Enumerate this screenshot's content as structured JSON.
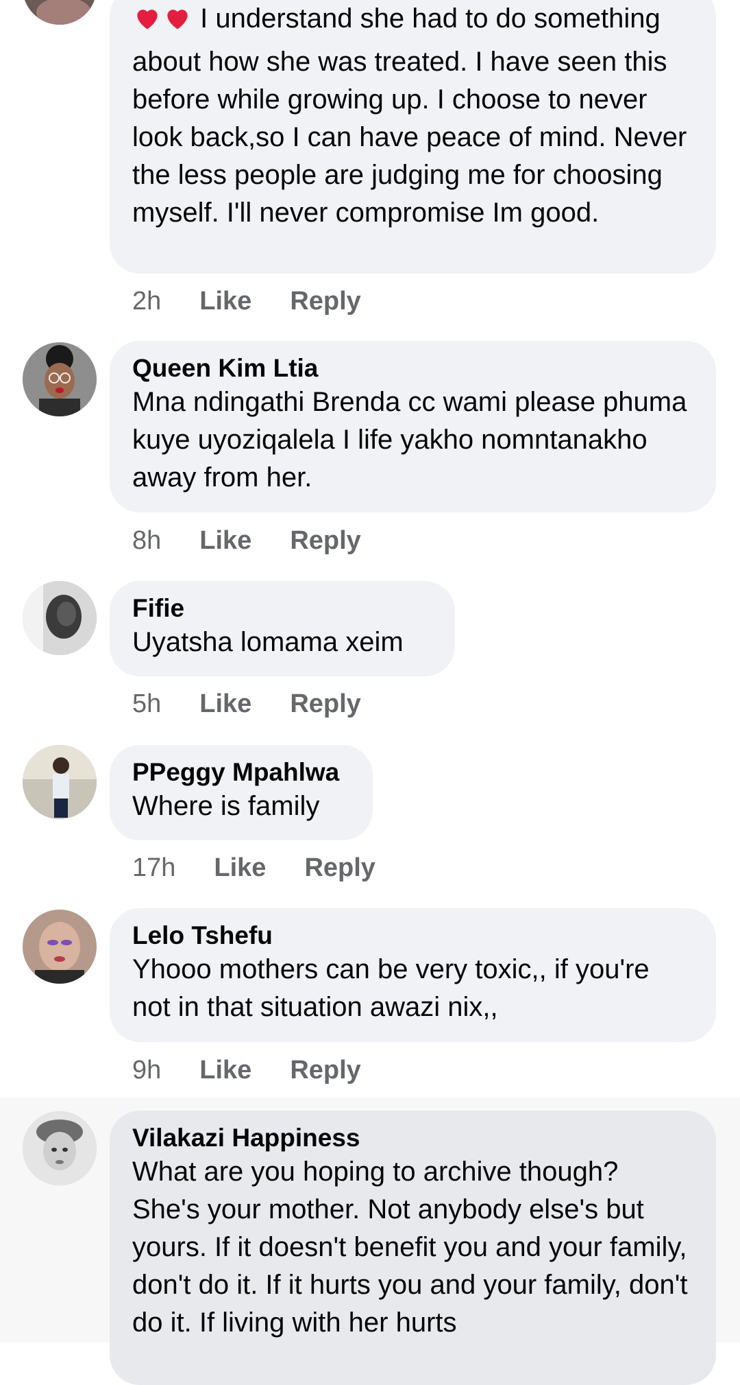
{
  "comments": [
    {
      "text_prefix_emoji": "❤️❤️",
      "text": "I understand she had to do something about how she was treated. I have seen this before while growing up. I choose to never look back,so I can have peace of mind. Never the less people are judging me for choosing myself. I'll never compromise Im good.",
      "time": "2h",
      "like": "Like",
      "reply": "Reply"
    },
    {
      "name": "Queen Kim Ltia",
      "text": "Mna ndingathi Brenda cc wami please phuma kuye uyoziqalela I life yakho nomntanakho away from her.",
      "time": "8h",
      "like": "Like",
      "reply": "Reply"
    },
    {
      "name": "Fifie",
      "text": "Uyatsha lomama xeim",
      "time": "5h",
      "like": "Like",
      "reply": "Reply"
    },
    {
      "name": "PPeggy Mpahlwa",
      "text": "Where is family",
      "time": "17h",
      "like": "Like",
      "reply": "Reply"
    },
    {
      "name": "Lelo Tshefu",
      "text": "Yhooo mothers can be very toxic,, if you're not in that situation awazi nix,,",
      "time": "9h",
      "like": "Like",
      "reply": "Reply"
    },
    {
      "name": "Vilakazi Happiness",
      "text": "What are you hoping to archive though? She's your mother. Not anybody else's but yours. If it doesn't benefit you and your family, don't do it. If it hurts you and your family, don't do it. If living with her hurts"
    }
  ],
  "colors": {
    "bubble": "#f0f2f5",
    "secondary_text": "#65676b",
    "heart": "#e41e3f"
  }
}
